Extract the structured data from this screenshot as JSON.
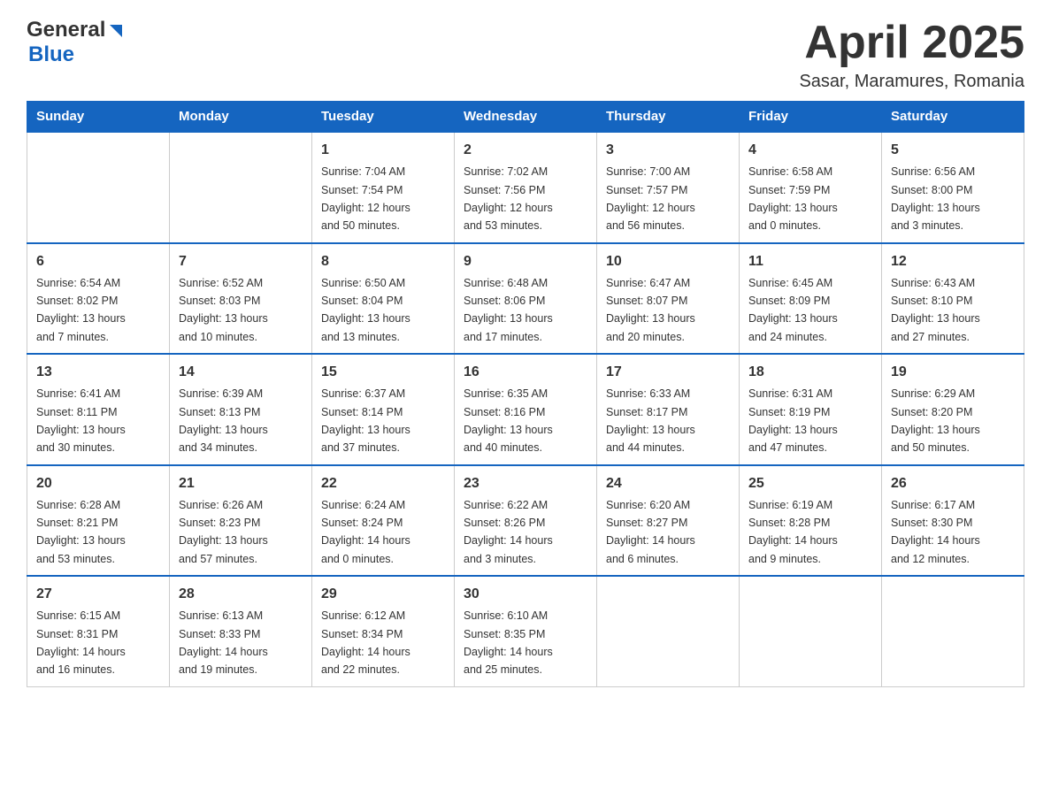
{
  "header": {
    "logo_general": "General",
    "logo_blue": "Blue",
    "title": "April 2025",
    "subtitle": "Sasar, Maramures, Romania"
  },
  "calendar": {
    "days": [
      "Sunday",
      "Monday",
      "Tuesday",
      "Wednesday",
      "Thursday",
      "Friday",
      "Saturday"
    ],
    "weeks": [
      [
        {
          "day": "",
          "info": ""
        },
        {
          "day": "",
          "info": ""
        },
        {
          "day": "1",
          "info": "Sunrise: 7:04 AM\nSunset: 7:54 PM\nDaylight: 12 hours\nand 50 minutes."
        },
        {
          "day": "2",
          "info": "Sunrise: 7:02 AM\nSunset: 7:56 PM\nDaylight: 12 hours\nand 53 minutes."
        },
        {
          "day": "3",
          "info": "Sunrise: 7:00 AM\nSunset: 7:57 PM\nDaylight: 12 hours\nand 56 minutes."
        },
        {
          "day": "4",
          "info": "Sunrise: 6:58 AM\nSunset: 7:59 PM\nDaylight: 13 hours\nand 0 minutes."
        },
        {
          "day": "5",
          "info": "Sunrise: 6:56 AM\nSunset: 8:00 PM\nDaylight: 13 hours\nand 3 minutes."
        }
      ],
      [
        {
          "day": "6",
          "info": "Sunrise: 6:54 AM\nSunset: 8:02 PM\nDaylight: 13 hours\nand 7 minutes."
        },
        {
          "day": "7",
          "info": "Sunrise: 6:52 AM\nSunset: 8:03 PM\nDaylight: 13 hours\nand 10 minutes."
        },
        {
          "day": "8",
          "info": "Sunrise: 6:50 AM\nSunset: 8:04 PM\nDaylight: 13 hours\nand 13 minutes."
        },
        {
          "day": "9",
          "info": "Sunrise: 6:48 AM\nSunset: 8:06 PM\nDaylight: 13 hours\nand 17 minutes."
        },
        {
          "day": "10",
          "info": "Sunrise: 6:47 AM\nSunset: 8:07 PM\nDaylight: 13 hours\nand 20 minutes."
        },
        {
          "day": "11",
          "info": "Sunrise: 6:45 AM\nSunset: 8:09 PM\nDaylight: 13 hours\nand 24 minutes."
        },
        {
          "day": "12",
          "info": "Sunrise: 6:43 AM\nSunset: 8:10 PM\nDaylight: 13 hours\nand 27 minutes."
        }
      ],
      [
        {
          "day": "13",
          "info": "Sunrise: 6:41 AM\nSunset: 8:11 PM\nDaylight: 13 hours\nand 30 minutes."
        },
        {
          "day": "14",
          "info": "Sunrise: 6:39 AM\nSunset: 8:13 PM\nDaylight: 13 hours\nand 34 minutes."
        },
        {
          "day": "15",
          "info": "Sunrise: 6:37 AM\nSunset: 8:14 PM\nDaylight: 13 hours\nand 37 minutes."
        },
        {
          "day": "16",
          "info": "Sunrise: 6:35 AM\nSunset: 8:16 PM\nDaylight: 13 hours\nand 40 minutes."
        },
        {
          "day": "17",
          "info": "Sunrise: 6:33 AM\nSunset: 8:17 PM\nDaylight: 13 hours\nand 44 minutes."
        },
        {
          "day": "18",
          "info": "Sunrise: 6:31 AM\nSunset: 8:19 PM\nDaylight: 13 hours\nand 47 minutes."
        },
        {
          "day": "19",
          "info": "Sunrise: 6:29 AM\nSunset: 8:20 PM\nDaylight: 13 hours\nand 50 minutes."
        }
      ],
      [
        {
          "day": "20",
          "info": "Sunrise: 6:28 AM\nSunset: 8:21 PM\nDaylight: 13 hours\nand 53 minutes."
        },
        {
          "day": "21",
          "info": "Sunrise: 6:26 AM\nSunset: 8:23 PM\nDaylight: 13 hours\nand 57 minutes."
        },
        {
          "day": "22",
          "info": "Sunrise: 6:24 AM\nSunset: 8:24 PM\nDaylight: 14 hours\nand 0 minutes."
        },
        {
          "day": "23",
          "info": "Sunrise: 6:22 AM\nSunset: 8:26 PM\nDaylight: 14 hours\nand 3 minutes."
        },
        {
          "day": "24",
          "info": "Sunrise: 6:20 AM\nSunset: 8:27 PM\nDaylight: 14 hours\nand 6 minutes."
        },
        {
          "day": "25",
          "info": "Sunrise: 6:19 AM\nSunset: 8:28 PM\nDaylight: 14 hours\nand 9 minutes."
        },
        {
          "day": "26",
          "info": "Sunrise: 6:17 AM\nSunset: 8:30 PM\nDaylight: 14 hours\nand 12 minutes."
        }
      ],
      [
        {
          "day": "27",
          "info": "Sunrise: 6:15 AM\nSunset: 8:31 PM\nDaylight: 14 hours\nand 16 minutes."
        },
        {
          "day": "28",
          "info": "Sunrise: 6:13 AM\nSunset: 8:33 PM\nDaylight: 14 hours\nand 19 minutes."
        },
        {
          "day": "29",
          "info": "Sunrise: 6:12 AM\nSunset: 8:34 PM\nDaylight: 14 hours\nand 22 minutes."
        },
        {
          "day": "30",
          "info": "Sunrise: 6:10 AM\nSunset: 8:35 PM\nDaylight: 14 hours\nand 25 minutes."
        },
        {
          "day": "",
          "info": ""
        },
        {
          "day": "",
          "info": ""
        },
        {
          "day": "",
          "info": ""
        }
      ]
    ]
  }
}
